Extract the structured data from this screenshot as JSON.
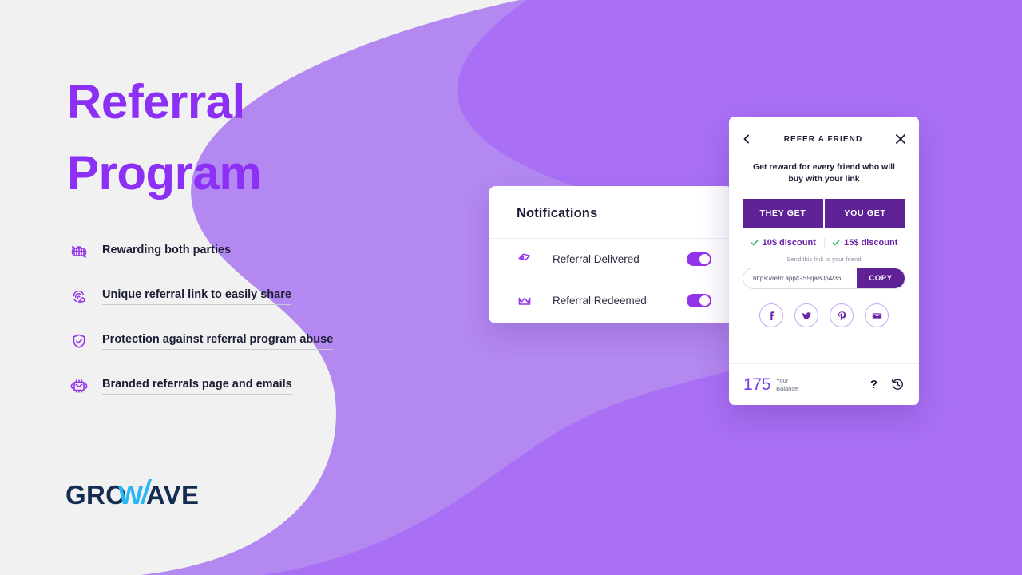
{
  "theme": {
    "page_bg": "#f1f1f2",
    "heading_purple": "#8c30f5",
    "wave_light": "#b388f0",
    "wave_dark": "#a970f5",
    "tab_purple": "#5f2196",
    "toggle_purple": "#9333ea",
    "check_green": "#2eb872",
    "logo_navy": "#152c52",
    "logo_cyan": "#29b6f6"
  },
  "hero": {
    "title_line1": "Referral",
    "title_line2": "Program"
  },
  "features": [
    {
      "icon": "gift-refresh-icon",
      "label": "Rewarding both parties"
    },
    {
      "icon": "fingerprint-link-icon",
      "label": "Unique referral link to easily share"
    },
    {
      "icon": "shield-check-icon",
      "label": "Protection against referral program abuse"
    },
    {
      "icon": "branded-email-icon",
      "label": "Branded referrals page and emails"
    }
  ],
  "logo": {
    "text_part1": "GRO",
    "text_accent": "W",
    "text_part2": "AVE"
  },
  "notifications": {
    "title": "Notifications",
    "rows": [
      {
        "icon": "tag-icon",
        "label": "Referral Delivered",
        "toggle": "on"
      },
      {
        "icon": "crown-icon",
        "label": "Referral Redeemed",
        "toggle": "on"
      }
    ]
  },
  "referral_card": {
    "back_icon": "chevron-left-icon",
    "title": "REFER A FRIEND",
    "close_icon": "close-icon",
    "subtitle": "Get reward for every friend who will buy with your link",
    "tabs": [
      {
        "label": "THEY GET"
      },
      {
        "label": "YOU GET"
      }
    ],
    "rewards": [
      {
        "check_icon": "check-icon",
        "text": "10$ discount"
      },
      {
        "check_icon": "check-icon",
        "text": "15$ discount"
      }
    ],
    "send_label": "Send this link to your friend",
    "link_value": "https://refrr.app/GS5rjaBJp4/36",
    "link_placeholder": "https://refrr.app/",
    "copy_label": "COPY",
    "social": [
      {
        "icon": "facebook-icon"
      },
      {
        "icon": "twitter-icon"
      },
      {
        "icon": "pinterest-icon"
      },
      {
        "icon": "email-icon"
      }
    ],
    "footer": {
      "balance_value": "175",
      "balance_label_line1": "Your",
      "balance_label_line2": "Balance",
      "help_label": "?",
      "history_icon": "history-clock-icon"
    }
  }
}
